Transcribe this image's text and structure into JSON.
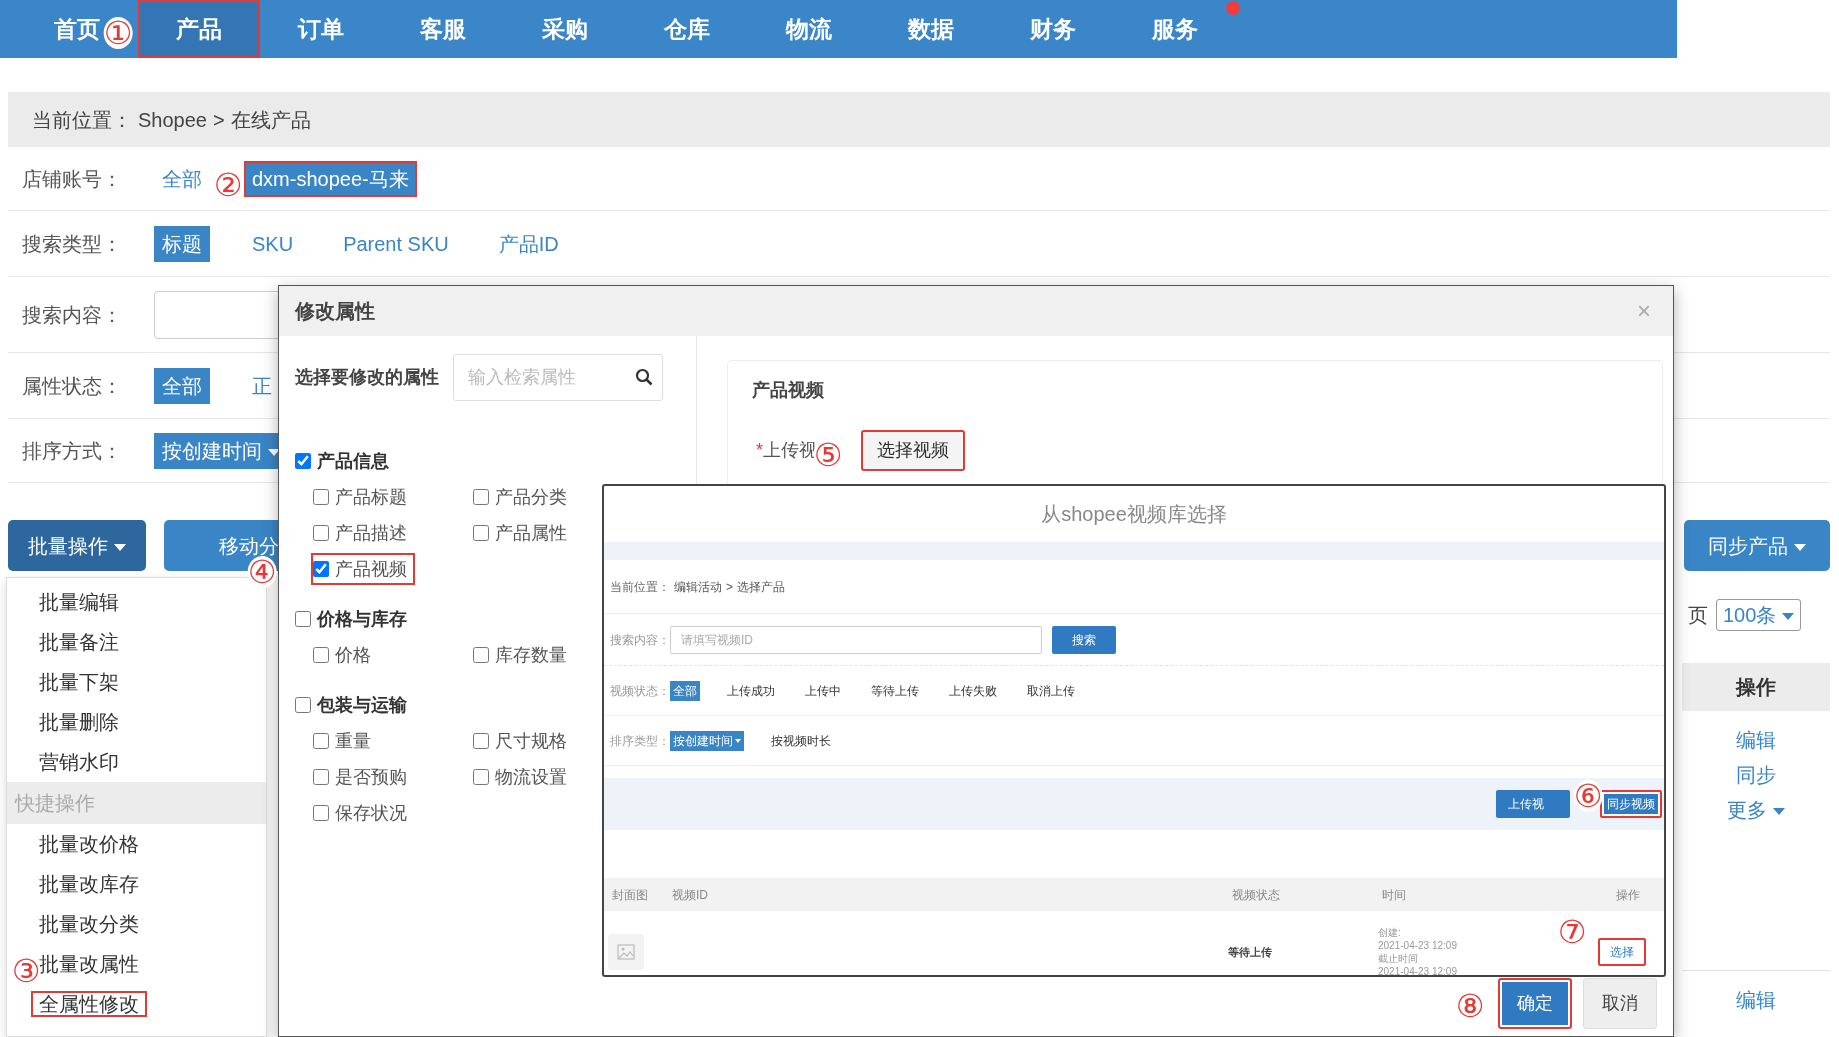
{
  "top_nav": {
    "items": [
      {
        "label": "首页",
        "selected": false,
        "boxed": false,
        "dot": false
      },
      {
        "label": "产品",
        "selected": true,
        "boxed": true,
        "dot": false
      },
      {
        "label": "订单",
        "selected": false,
        "boxed": false,
        "dot": false
      },
      {
        "label": "客服",
        "selected": false,
        "boxed": false,
        "dot": false
      },
      {
        "label": "采购",
        "selected": false,
        "boxed": false,
        "dot": false
      },
      {
        "label": "仓库",
        "selected": false,
        "boxed": false,
        "dot": false
      },
      {
        "label": "物流",
        "selected": false,
        "boxed": false,
        "dot": false
      },
      {
        "label": "数据",
        "selected": false,
        "boxed": false,
        "dot": false
      },
      {
        "label": "财务",
        "selected": false,
        "boxed": false,
        "dot": false
      },
      {
        "label": "服务",
        "selected": false,
        "boxed": false,
        "dot": true
      }
    ]
  },
  "breadcrumb": {
    "label": "当前位置：",
    "path": [
      "Shopee",
      "在线产品"
    ],
    "separator": ">"
  },
  "filters": [
    {
      "kind": "options",
      "label": "店铺账号：",
      "options": [
        {
          "label": "全部",
          "selected": false,
          "boxed": false
        },
        {
          "label": "dxm-shopee-马来",
          "selected": true,
          "boxed": true
        }
      ]
    },
    {
      "kind": "options",
      "label": "搜索类型：",
      "options": [
        {
          "label": "标题",
          "selected": true,
          "boxed": false
        },
        {
          "label": "SKU",
          "selected": false,
          "boxed": false
        },
        {
          "label": "Parent SKU",
          "selected": false,
          "boxed": false
        },
        {
          "label": "产品ID",
          "selected": false,
          "boxed": false
        }
      ]
    },
    {
      "kind": "input",
      "label": "搜索内容："
    },
    {
      "kind": "options",
      "label": "属性状态：",
      "options": [
        {
          "label": "全部",
          "selected": true,
          "boxed": false
        },
        {
          "label": "正",
          "selected": false,
          "boxed": false
        }
      ]
    },
    {
      "kind": "dropdown",
      "label": "排序方式：",
      "value": "按创建时间"
    }
  ],
  "toolbar": {
    "batch_button": "批量操作",
    "move_button": "移动分",
    "sync_button": "同步产品"
  },
  "batch_menu": {
    "items": [
      {
        "kind": "item",
        "label": "批量编辑",
        "boxed": false
      },
      {
        "kind": "item",
        "label": "批量备注",
        "boxed": false
      },
      {
        "kind": "item",
        "label": "批量下架",
        "boxed": false
      },
      {
        "kind": "item",
        "label": "批量删除",
        "boxed": false
      },
      {
        "kind": "item",
        "label": "营销水印",
        "boxed": false
      },
      {
        "kind": "header",
        "label": "快捷操作"
      },
      {
        "kind": "item",
        "label": "批量改价格",
        "boxed": false
      },
      {
        "kind": "item",
        "label": "批量改库存",
        "boxed": false
      },
      {
        "kind": "item",
        "label": "批量改分类",
        "boxed": false
      },
      {
        "kind": "item",
        "label": "批量改属性",
        "boxed": false
      },
      {
        "kind": "item",
        "label": "全属性修改",
        "boxed": true
      }
    ]
  },
  "pager": {
    "label": "页",
    "page_size": "100条"
  },
  "table": {
    "header": "操作",
    "rows": [
      {
        "actions": [
          {
            "kind": "link",
            "label": "编辑"
          },
          {
            "kind": "link",
            "label": "同步"
          },
          {
            "kind": "dropdown",
            "label": "更多"
          }
        ]
      },
      {
        "actions": [
          {
            "kind": "link",
            "label": "编辑"
          }
        ]
      }
    ]
  },
  "modal": {
    "title": "修改属性",
    "close": "×",
    "prompt": "选择要修改的属性",
    "search_placeholder": "输入检索属性",
    "groups": [
      {
        "label": "产品信息",
        "checked": true,
        "items": [
          {
            "label": "产品标题",
            "checked": false,
            "boxed": false
          },
          {
            "label": "产品分类",
            "checked": false,
            "boxed": false
          },
          {
            "label": "产品描述",
            "checked": false,
            "boxed": false
          },
          {
            "label": "产品属性",
            "checked": false,
            "boxed": false
          },
          {
            "label": "产品视频",
            "checked": true,
            "boxed": true
          }
        ]
      },
      {
        "label": "价格与库存",
        "checked": false,
        "items": [
          {
            "label": "价格",
            "checked": false,
            "boxed": false
          },
          {
            "label": "库存数量",
            "checked": false,
            "boxed": false
          }
        ]
      },
      {
        "label": "包装与运输",
        "checked": false,
        "items": [
          {
            "label": "重量",
            "checked": false,
            "boxed": false
          },
          {
            "label": "尺寸规格",
            "checked": false,
            "boxed": false
          },
          {
            "label": "是否预购",
            "checked": false,
            "boxed": false
          },
          {
            "label": "物流设置",
            "checked": false,
            "boxed": false
          },
          {
            "label": "保存状况",
            "checked": false,
            "boxed": false
          }
        ]
      }
    ],
    "section_title": "产品视频",
    "upload_label": "上传视",
    "required_mark": "*",
    "choose_button": {
      "label": "选择视频",
      "boxed": true
    },
    "ok_button": {
      "label": "确定",
      "boxed": true
    },
    "cancel_button": {
      "label": "取消",
      "boxed": false
    }
  },
  "video_library": {
    "title": "从shopee视频库选择",
    "breadcrumb": {
      "label": "当前位置：",
      "path": [
        "编辑活动",
        "选择产品"
      ],
      "separator": ">"
    },
    "search": {
      "label": "搜索内容：",
      "placeholder": "请填写视频ID",
      "button": "搜索"
    },
    "status_filter": {
      "label": "视频状态：",
      "options": [
        {
          "label": "全部",
          "selected": true
        },
        {
          "label": "上传成功",
          "selected": false
        },
        {
          "label": "上传中",
          "selected": false
        },
        {
          "label": "等待上传",
          "selected": false
        },
        {
          "label": "上传失败",
          "selected": false
        },
        {
          "label": "取消上传",
          "selected": false
        }
      ]
    },
    "sort": {
      "label": "排序类型：",
      "options": [
        {
          "label": "按创建时间",
          "selected": true
        },
        {
          "label": "按视频时长",
          "selected": false
        }
      ]
    },
    "upload_button": {
      "label": "上传视",
      "boxed": false
    },
    "sync_button": {
      "label": "同步视频",
      "boxed": true
    },
    "columns": [
      "封面图",
      "视频ID",
      "视频状态",
      "时间",
      "操作"
    ],
    "rows": [
      {
        "status": "等待上传",
        "time_lines": [
          "创建:",
          "2021-04-23 12:09",
          "截止时间",
          "2021-04-23 12:09"
        ],
        "action": {
          "label": "选择",
          "boxed": true
        }
      }
    ]
  },
  "annotations": [
    "①",
    "②",
    "③",
    "④",
    "⑤",
    "⑥",
    "⑦",
    "⑧"
  ]
}
